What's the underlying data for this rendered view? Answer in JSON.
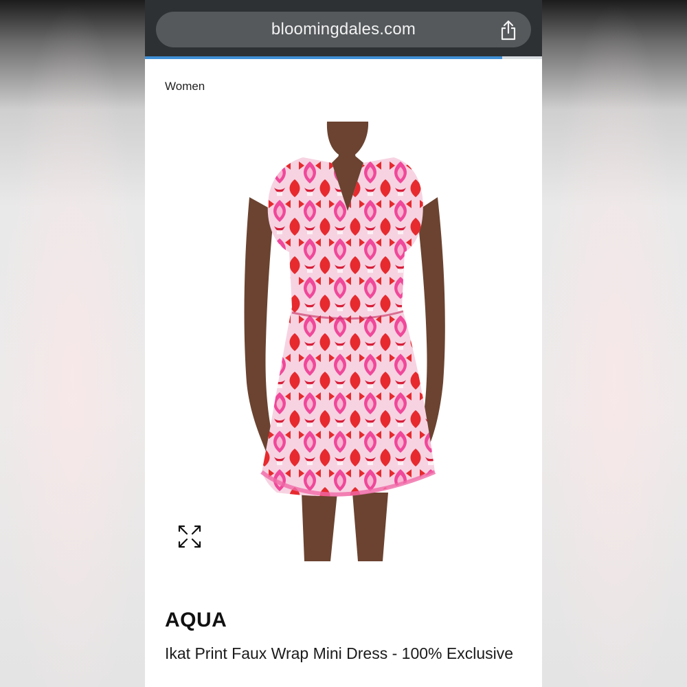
{
  "browser": {
    "url": "bloomingdales.com",
    "share_icon": "share-icon",
    "load_progress_percent": 90,
    "progress_color": "#3f8fd6"
  },
  "page": {
    "breadcrumb": "Women",
    "expand_icon": "expand-icon",
    "brand": "AQUA",
    "product_name": "Ikat Print Faux Wrap Mini Dress - 100% Exclusive"
  },
  "colors": {
    "dress_pink": "#f0489a",
    "dress_red": "#e62a2e",
    "skin": "#6b4330"
  }
}
